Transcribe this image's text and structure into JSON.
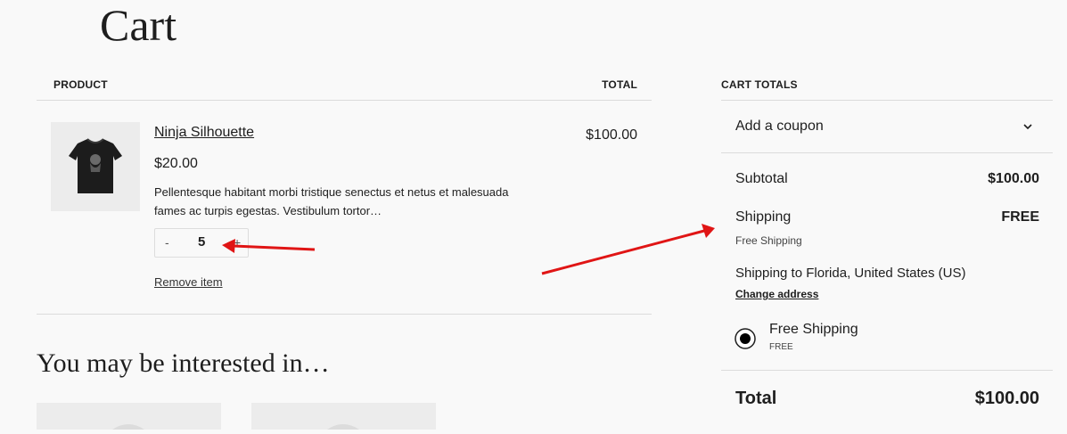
{
  "page": {
    "title": "Cart"
  },
  "cart_table": {
    "product_header": "PRODUCT",
    "total_header": "TOTAL"
  },
  "item": {
    "name": "Ninja Silhouette",
    "price": "$20.00",
    "description": "Pellentesque habitant morbi tristique senectus et netus et malesuada fames ac turpis egestas. Vestibulum tortor…",
    "quantity": "5",
    "minus_label": "-",
    "plus_label": "+",
    "remove_label": "Remove item",
    "line_total": "$100.00",
    "image_icon": "tshirt-icon"
  },
  "cross_sells": {
    "title": "You may be interested in…"
  },
  "totals": {
    "header": "CART TOTALS",
    "coupon_label": "Add a coupon",
    "subtotal_label": "Subtotal",
    "subtotal_value": "$100.00",
    "shipping_label": "Shipping",
    "shipping_value": "FREE",
    "shipping_method": "Free Shipping",
    "shipping_to": "Shipping to Florida, United States (US)",
    "change_address": "Change address",
    "option_label": "Free Shipping",
    "option_price": "FREE",
    "total_label": "Total",
    "total_value": "$100.00"
  },
  "annotations": {
    "arrow_color": "#e01515"
  }
}
